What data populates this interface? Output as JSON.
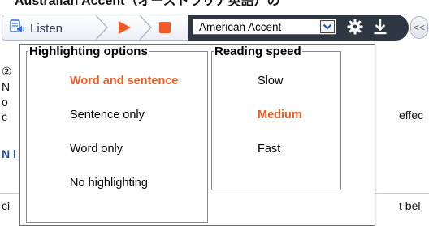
{
  "background": {
    "heading": "Australian Accent（オーストラリア英語）の",
    "fragments": {
      "f1": "②",
      "f2": "N",
      "f3": "o",
      "f4": "c",
      "f5": "effec",
      "f6": "N l",
      "f7": "ci",
      "f8": "t bel"
    }
  },
  "toolbar": {
    "listen_label": "Listen",
    "accent": {
      "selected": "American Accent"
    },
    "collapse_label": "<<"
  },
  "settings_panel": {
    "highlighting": {
      "legend": "Highlighting options",
      "options": [
        "Word and sentence",
        "Sentence only",
        "Word only",
        "No highlighting"
      ],
      "selected_index": 0
    },
    "reading_speed": {
      "legend": "Reading speed",
      "options": [
        "Slow",
        "Medium",
        "Fast"
      ],
      "selected_index": 1
    }
  },
  "colors": {
    "accent_orange": "#f15a22",
    "toolbar_dark": "#2f3742",
    "speaker_blue": "#2f6fd6"
  },
  "icons": [
    "speaker-icon",
    "play-icon",
    "stop-icon",
    "chevron-down-icon",
    "gear-icon",
    "download-icon",
    "collapse-icon"
  ]
}
